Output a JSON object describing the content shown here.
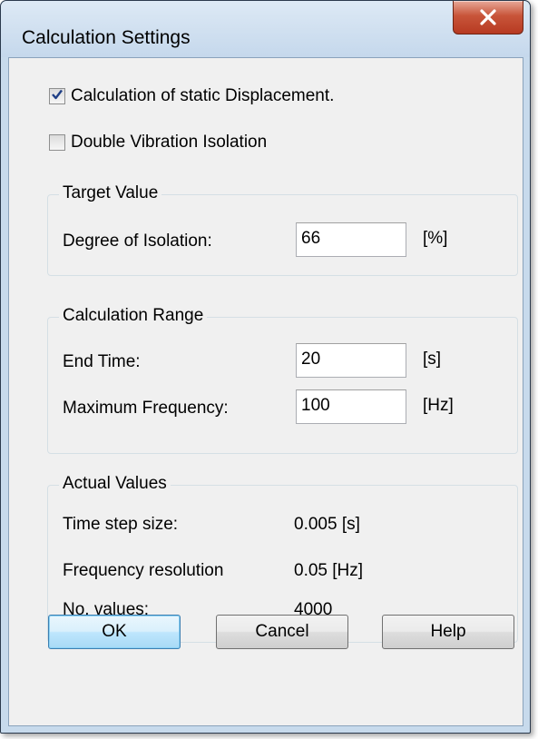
{
  "window": {
    "title": "Calculation Settings"
  },
  "options": {
    "static_displacement": {
      "label": "Calculation of static Displacement.",
      "checked": true
    },
    "double_isolation": {
      "label": "Double Vibration Isolation",
      "checked": false
    }
  },
  "target_value": {
    "title": "Target Value",
    "degree_label": "Degree of Isolation:",
    "degree_value": "66",
    "degree_unit": "[%]"
  },
  "calc_range": {
    "title": "Calculation Range",
    "end_time_label": "End Time:",
    "end_time_value": "20",
    "end_time_unit": "[s]",
    "max_freq_label": "Maximum Frequency:",
    "max_freq_value": "100",
    "max_freq_unit": "[Hz]"
  },
  "actual_values": {
    "title": "Actual Values",
    "time_step_label": "Time step size:",
    "time_step_value": "0.005 [s]",
    "freq_res_label": "Frequency resolution",
    "freq_res_value": "0.05 [Hz]",
    "num_values_label": "No. values:",
    "num_values_value": "4000"
  },
  "buttons": {
    "ok": "OK",
    "cancel": "Cancel",
    "help": "Help"
  },
  "colors": {
    "frame": "#c7daec",
    "client": "#f0f0f0",
    "close_button": "#c8553a",
    "default_button": "#3c7fb1"
  }
}
